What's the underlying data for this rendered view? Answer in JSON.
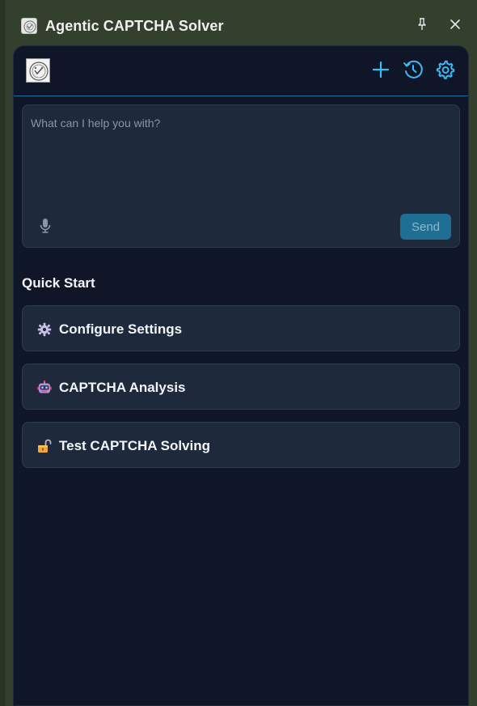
{
  "window": {
    "title": "Agentic CAPTCHA Solver"
  },
  "header": {
    "icons": [
      "plus-icon",
      "history-icon",
      "gear-icon"
    ],
    "accent_color": "#38bdf8"
  },
  "prompt": {
    "placeholder": "What can I help you with?",
    "value": "",
    "send_label": "Send"
  },
  "quick_start": {
    "title": "Quick Start",
    "items": [
      {
        "label": "Configure Settings",
        "icon": "gear-icon"
      },
      {
        "label": "CAPTCHA Analysis",
        "icon": "robot-icon"
      },
      {
        "label": "Test CAPTCHA Solving",
        "icon": "unlock-icon"
      }
    ]
  }
}
